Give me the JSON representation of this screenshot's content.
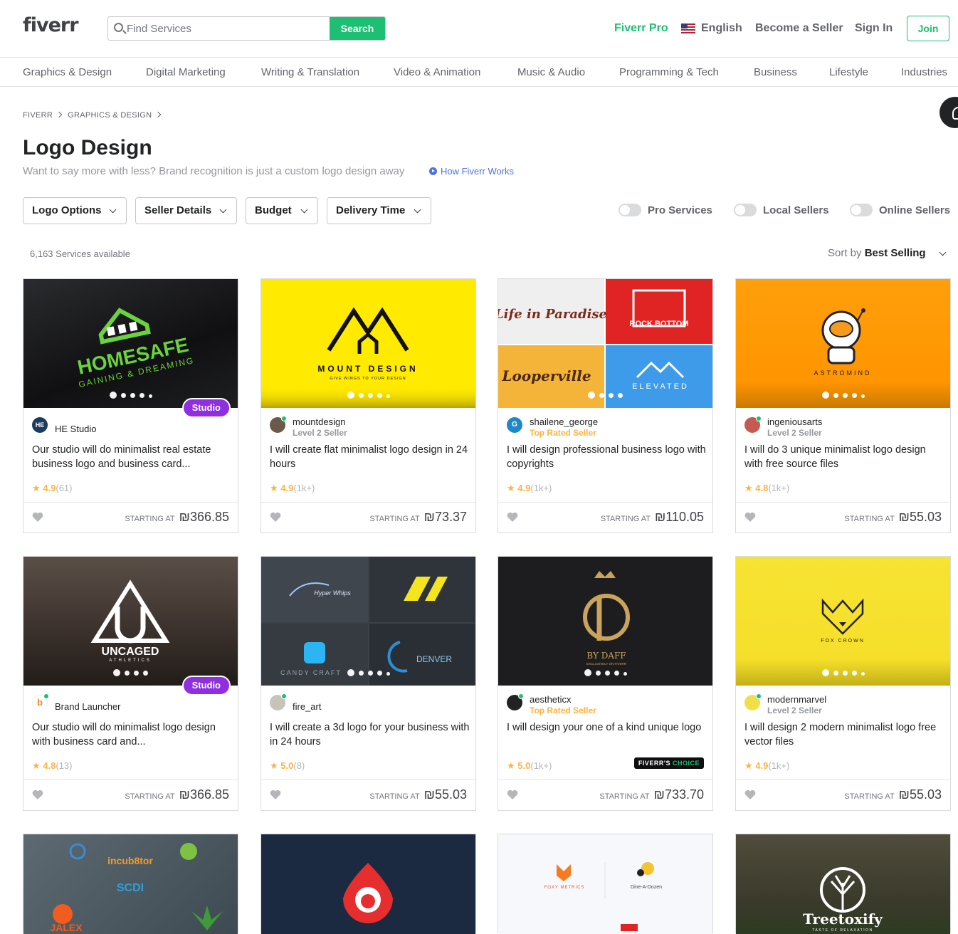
{
  "header": {
    "logo": "fiverr",
    "search_placeholder": "Find Services",
    "search_button": "Search",
    "fiverr_pro": "Fiverr Pro",
    "language": "English",
    "become_seller": "Become a Seller",
    "sign_in": "Sign In",
    "join": "Join"
  },
  "categories": [
    "Graphics & Design",
    "Digital Marketing",
    "Writing & Translation",
    "Video & Animation",
    "Music & Audio",
    "Programming & Tech",
    "Business",
    "Lifestyle",
    "Industries"
  ],
  "breadcrumb": [
    "FIVERR",
    "GRAPHICS & DESIGN"
  ],
  "page": {
    "title": "Logo Design",
    "subtitle": "Want to say more with less? Brand recognition is just a custom logo design away",
    "how_link": "How Fiverr Works"
  },
  "filters": [
    "Logo Options",
    "Seller Details",
    "Budget",
    "Delivery Time"
  ],
  "toggles": [
    "Pro Services",
    "Local Sellers",
    "Online Sellers"
  ],
  "results": {
    "count": "6,163 Services available",
    "sort_label": "Sort by",
    "sort_value": "Best Selling"
  },
  "starting_at": "STARTING AT",
  "studio_badge": "Studio",
  "gigs": [
    {
      "seller": "HE Studio",
      "level": "",
      "title": "Our studio will do minimalist real estate business logo and business card...",
      "rating": "4.9",
      "reviews": "(61)",
      "price": "₪366.85",
      "studio": true,
      "choice": false,
      "thumb_text": "HOMESAFE",
      "thumb_sub": "GAINING & DREAMING"
    },
    {
      "seller": "mountdesign",
      "level": "Level 2 Seller",
      "title": "I will create flat minimalist logo design in 24 hours",
      "rating": "4.9",
      "reviews": "(1k+)",
      "price": "₪73.37",
      "studio": false,
      "choice": false,
      "thumb_text": "MOUNT DESIGN",
      "thumb_sub": "GIVE WINGS TO YOUR DESIGN"
    },
    {
      "seller": "shailene_george",
      "level": "Top Rated Seller",
      "title": "I will design professional business logo with copyrights",
      "rating": "4.9",
      "reviews": "(1k+)",
      "price": "₪110.05",
      "studio": false,
      "choice": false,
      "thumb_text": "Life in Paradise",
      "thumb_sub": "ROCK BOTTOM",
      "thumb_text3": "Looperville",
      "thumb_text4": "ELEVATED"
    },
    {
      "seller": "ingeniousarts",
      "level": "Level 2 Seller",
      "title": "I will do 3 unique minimalist logo design with free source files",
      "rating": "4.8",
      "reviews": "(1k+)",
      "price": "₪55.03",
      "studio": false,
      "choice": false,
      "thumb_text": "ASTROMIND",
      "thumb_sub": ""
    },
    {
      "seller": "Brand Launcher",
      "level": "",
      "title": "Our studio will do minimalist logo design with business card and...",
      "rating": "4.8",
      "reviews": "(13)",
      "price": "₪366.85",
      "studio": true,
      "choice": false,
      "thumb_text": "UNCAGED",
      "thumb_sub": "ATHLETICS"
    },
    {
      "seller": "fire_art",
      "level": "",
      "title": "I will create a 3d logo for your business with in 24 hours",
      "rating": "5.0",
      "reviews": "(8)",
      "price": "₪55.03",
      "studio": false,
      "choice": false,
      "thumb_text": "Hyper Whips",
      "thumb_sub": "DENVER",
      "thumb_text3": "CANDY CRAFT"
    },
    {
      "seller": "aestheticx",
      "level": "Top Rated Seller",
      "title": "I will design your one of a kind unique logo",
      "rating": "5.0",
      "reviews": "(1k+)",
      "price": "₪733.70",
      "studio": false,
      "choice": true,
      "thumb_text": "BY DAFF",
      "thumb_sub": "EXCLUSIVELY ON FIVERR"
    },
    {
      "seller": "modernmarvel",
      "level": "Level 2 Seller",
      "title": "I will design 2 modern minimalist logo free vector files",
      "rating": "4.9",
      "reviews": "(1k+)",
      "price": "₪55.03",
      "studio": false,
      "choice": false,
      "thumb_text": "FOX CROWN",
      "thumb_sub": ""
    },
    {
      "thumb_text": "incub8tor",
      "thumb_sub": "JALEX"
    },
    {
      "thumb_text": ""
    },
    {
      "thumb_text": "FOXY METRICS",
      "thumb_sub": "Dine-A-Dozen"
    },
    {
      "thumb_text": "Treetoxify",
      "thumb_sub": "TASTE OF RELAXATION"
    }
  ],
  "choice_badge": {
    "a": "FIVERR'S",
    "b": "CHOICE"
  }
}
